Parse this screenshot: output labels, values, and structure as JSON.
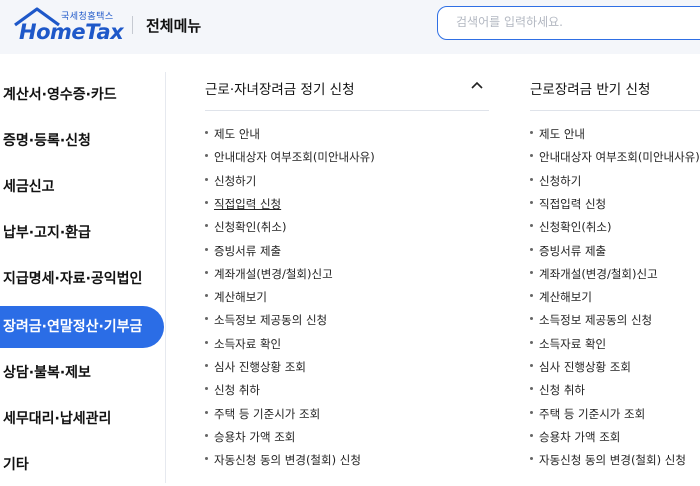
{
  "header": {
    "logo_sub": "국세청홈택스",
    "logo_main": "HomeTax",
    "title": "전체메뉴",
    "search_placeholder": "검색어를 입력하세요.",
    "brand_color": "#1e58c9",
    "accent_color": "#2b6de6"
  },
  "sidebar": {
    "items": [
      {
        "label": "계산서·영수증·카드",
        "active": false
      },
      {
        "label": "증명·등록·신청",
        "active": false
      },
      {
        "label": "세금신고",
        "active": false
      },
      {
        "label": "납부·고지·환급",
        "active": false
      },
      {
        "label": "지급명세·자료·공익법인",
        "active": false
      },
      {
        "label": "장려금·연말정산·기부금",
        "active": true
      },
      {
        "label": "상담·불복·제보",
        "active": false
      },
      {
        "label": "세무대리·납세관리",
        "active": false
      },
      {
        "label": "기타",
        "active": false
      }
    ]
  },
  "columns": [
    {
      "title": "근로·자녀장려금 정기 신청",
      "collapse_icon": "chevron-up-icon",
      "items": [
        {
          "label": "제도 안내",
          "underlined": false
        },
        {
          "label": "안내대상자 여부조회(미안내사유)",
          "underlined": false
        },
        {
          "label": "신청하기",
          "underlined": false
        },
        {
          "label": "직접입력 신청",
          "underlined": true
        },
        {
          "label": "신청확인(취소)",
          "underlined": false
        },
        {
          "label": "증빙서류 제출",
          "underlined": false
        },
        {
          "label": "계좌개설(변경/철회)신고",
          "underlined": false
        },
        {
          "label": "계산해보기",
          "underlined": false
        },
        {
          "label": "소득정보 제공동의 신청",
          "underlined": false
        },
        {
          "label": "소득자료 확인",
          "underlined": false
        },
        {
          "label": "심사 진행상황 조회",
          "underlined": false
        },
        {
          "label": "신청 취하",
          "underlined": false
        },
        {
          "label": "주택 등 기준시가 조회",
          "underlined": false
        },
        {
          "label": "승용차 가액 조회",
          "underlined": false
        },
        {
          "label": "자동신청 동의 변경(철회) 신청",
          "underlined": false
        }
      ]
    },
    {
      "title": "근로장려금 반기 신청",
      "items": [
        {
          "label": "제도 안내",
          "underlined": false
        },
        {
          "label": "안내대상자 여부조회(미안내사유)",
          "underlined": false
        },
        {
          "label": "신청하기",
          "underlined": false
        },
        {
          "label": "직접입력 신청",
          "underlined": false
        },
        {
          "label": "신청확인(취소)",
          "underlined": false
        },
        {
          "label": "증빙서류 제출",
          "underlined": false
        },
        {
          "label": "계좌개설(변경/철회)신고",
          "underlined": false
        },
        {
          "label": "계산해보기",
          "underlined": false
        },
        {
          "label": "소득정보 제공동의 신청",
          "underlined": false
        },
        {
          "label": "소득자료 확인",
          "underlined": false
        },
        {
          "label": "심사 진행상황 조회",
          "underlined": false
        },
        {
          "label": "신청 취하",
          "underlined": false
        },
        {
          "label": "주택 등 기준시가 조회",
          "underlined": false
        },
        {
          "label": "승용차 가액 조회",
          "underlined": false
        },
        {
          "label": "자동신청 동의 변경(철회) 신청",
          "underlined": false
        }
      ]
    }
  ]
}
